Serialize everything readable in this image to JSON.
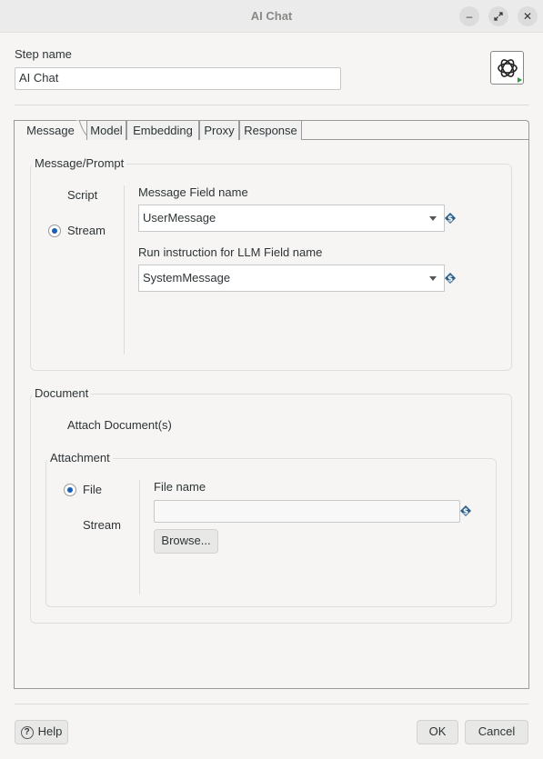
{
  "window": {
    "title": "AI Chat",
    "buttons": [
      "minimize",
      "maximize",
      "close"
    ]
  },
  "step": {
    "label": "Step name",
    "value": "AI Chat",
    "icon": "openai-logo-icon"
  },
  "tabs": [
    "Message",
    "Model",
    "Embedding",
    "Proxy",
    "Response"
  ],
  "message_prompt": {
    "title": "Message/Prompt",
    "options": [
      "Script",
      "Stream"
    ],
    "selected": "Stream",
    "message_field_label": "Message Field name",
    "message_field_value": "UserMessage",
    "run_instruction_label": "Run instruction for LLM Field name",
    "run_instruction_value": "SystemMessage"
  },
  "document": {
    "title": "Document",
    "attach_label": "Attach Document(s)",
    "attachment": {
      "title": "Attachment",
      "options": [
        "File",
        "Stream"
      ],
      "selected": "File",
      "file_name_label": "File name",
      "file_name_value": "",
      "browse_label": "Browse..."
    }
  },
  "footer": {
    "help": "Help",
    "ok": "OK",
    "cancel": "Cancel"
  }
}
